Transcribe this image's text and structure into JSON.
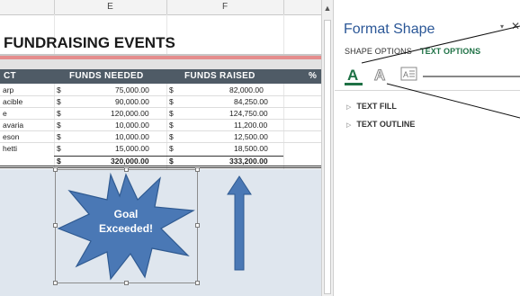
{
  "sheet": {
    "columns": [
      "E",
      "F"
    ],
    "title": "FUNDRAISING EVENTS",
    "headers": {
      "project": "CT",
      "needed": "FUNDS NEEDED",
      "raised": "FUNDS RAISED",
      "pct": "%"
    },
    "rows": [
      {
        "name": "arp",
        "needed_cur": "$",
        "needed": "75,000.00",
        "raised_cur": "$",
        "raised": "82,000.00"
      },
      {
        "name": "acible",
        "needed_cur": "$",
        "needed": "90,000.00",
        "raised_cur": "$",
        "raised": "84,250.00"
      },
      {
        "name": "e",
        "needed_cur": "$",
        "needed": "120,000.00",
        "raised_cur": "$",
        "raised": "124,750.00"
      },
      {
        "name": "avaria",
        "needed_cur": "$",
        "needed": "10,000.00",
        "raised_cur": "$",
        "raised": "11,200.00"
      },
      {
        "name": "eson",
        "needed_cur": "$",
        "needed": "10,000.00",
        "raised_cur": "$",
        "raised": "12,500.00"
      },
      {
        "name": "hetti",
        "needed_cur": "$",
        "needed": "15,000.00",
        "raised_cur": "$",
        "raised": "18,500.00"
      }
    ],
    "total": {
      "needed_cur": "$",
      "needed": "320,000.00",
      "raised_cur": "$",
      "raised": "333,200.00"
    },
    "starburst_text_line1": "Goal",
    "starburst_text_line2": "Exceeded!"
  },
  "pane": {
    "title": "Format Shape",
    "dropdown_icon": "▾",
    "close_icon": "✕",
    "tabs": {
      "shape_options": "SHAPE OPTIONS",
      "text_options": "TEXT OPTIONS"
    },
    "sections": {
      "text_fill": "TEXT FILL",
      "text_outline": "TEXT OUTLINE"
    },
    "icons": [
      "text-fill-outline-icon",
      "text-effects-icon",
      "textbox-icon"
    ]
  },
  "colors": {
    "pane_title": "#2b5797",
    "accent_green": "#1e7145",
    "header_dark": "#4f5b66",
    "starburst_fill": "#4a78b5",
    "arrow_fill": "#4a78b5"
  }
}
